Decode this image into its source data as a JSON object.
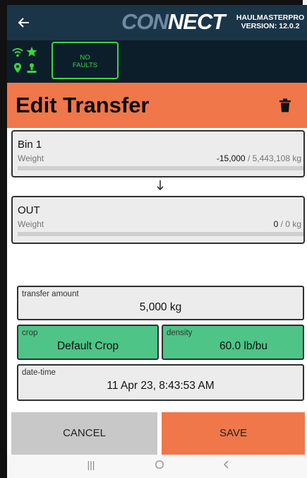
{
  "header": {
    "back_icon": "arrow-left-icon",
    "logo": {
      "part1": "CON",
      "part2": "NECT"
    },
    "product": "HAULMASTERPRO",
    "version": "VERSION: 12.0.2"
  },
  "status": {
    "icons": [
      "wifi-icon",
      "star-icon",
      "location-pin-icon",
      "person-icon"
    ],
    "icon_color": "#3bd640",
    "faults": {
      "line1": "NO",
      "line2": "FAULTS"
    }
  },
  "page": {
    "title": "Edit Transfer",
    "delete_icon": "trash-icon",
    "accent": "#ef774a"
  },
  "source": {
    "name": "Bin 1",
    "weight_label": "Weight",
    "weight_value": "-15,000",
    "weight_capacity": "/ 5,443,108 kg"
  },
  "direction_icon": "arrow-down-icon",
  "destination": {
    "name": "OUT",
    "weight_label": "Weight",
    "weight_value": "0",
    "weight_capacity": "/ 0 kg"
  },
  "form": {
    "transfer_amount": {
      "label": "transfer amount",
      "value": "5,000 kg"
    },
    "crop": {
      "label": "crop",
      "value": "Default Crop"
    },
    "density": {
      "label": "density",
      "value": "60.0 lb/bu"
    },
    "datetime": {
      "label": "date-time",
      "value": "11 Apr 23, 8:43:53 AM"
    }
  },
  "actions": {
    "cancel": "CANCEL",
    "save": "SAVE"
  },
  "navbar": {
    "recents": "|||",
    "home_icon": "circle-home-icon",
    "back_icon": "chevron-left-icon"
  }
}
